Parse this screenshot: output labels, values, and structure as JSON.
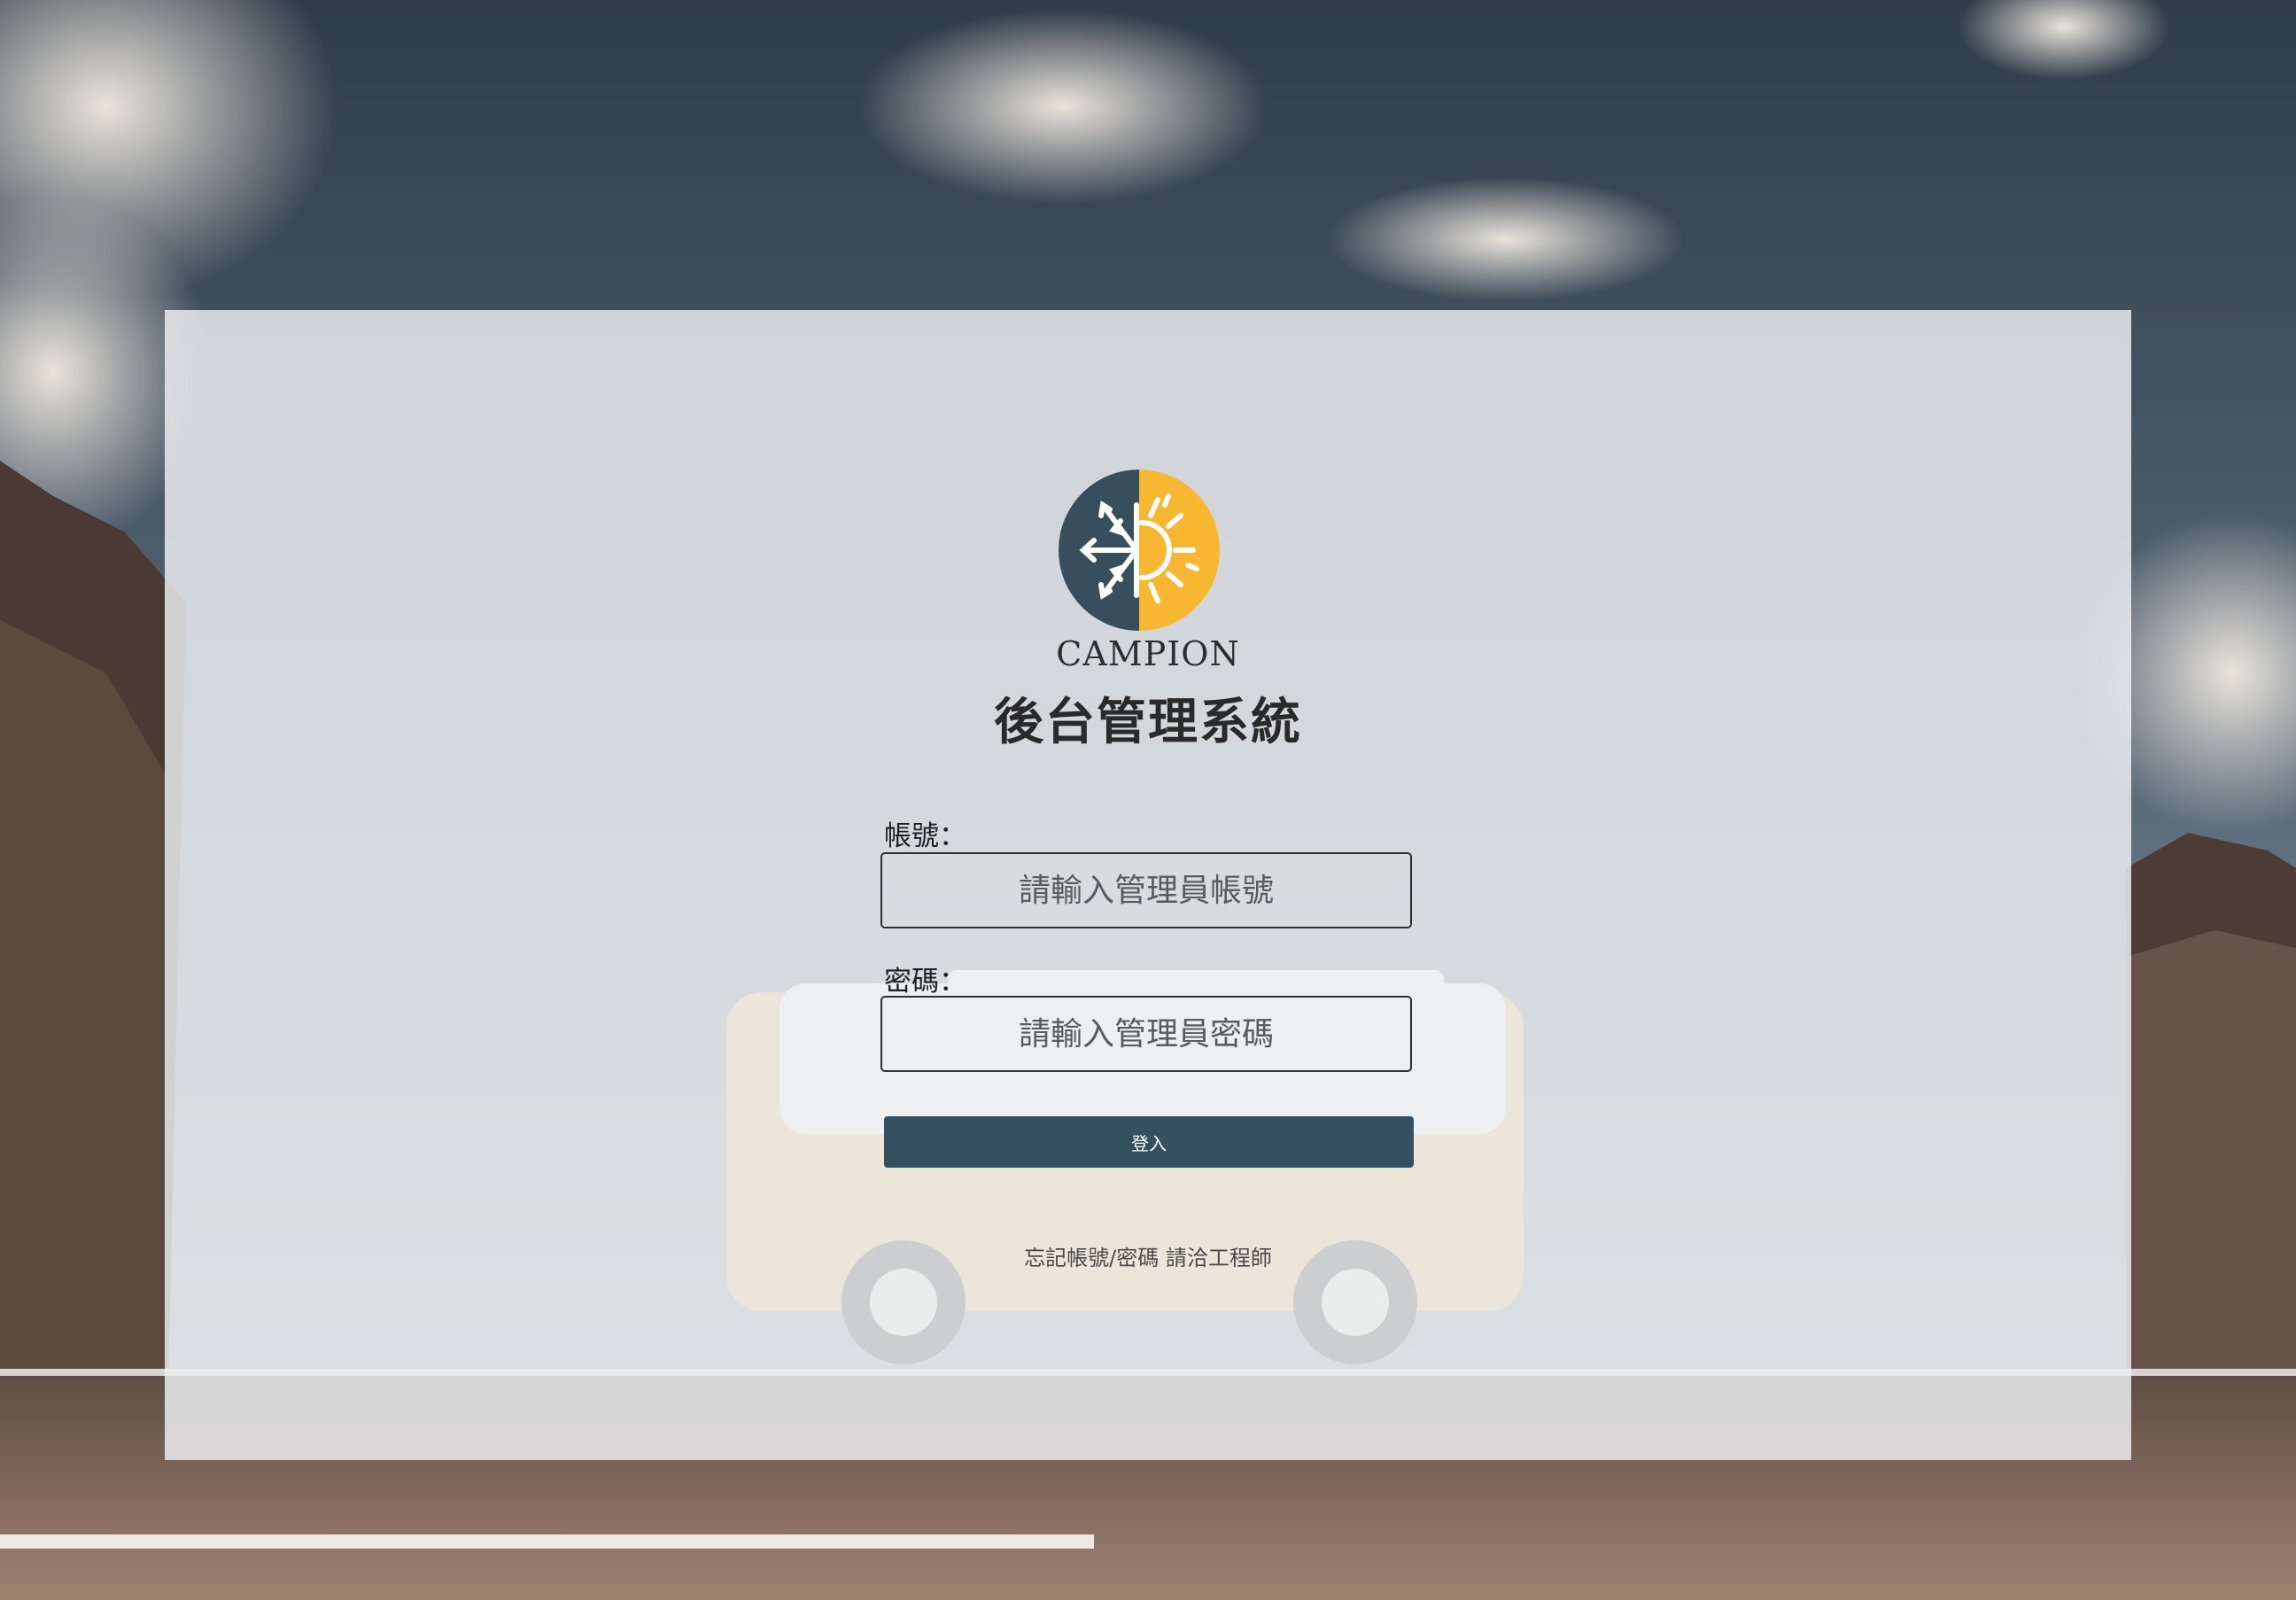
{
  "brand": {
    "name": "CAMPION",
    "logo_icon": "snowflake-sun-icon",
    "logo_colors": {
      "left": "#374f5d",
      "right": "#f7b731",
      "glyph": "#ffffff"
    }
  },
  "login": {
    "title": "後台管理系統",
    "account_label": "帳號：",
    "account_placeholder": "請輸入管理員帳號",
    "account_value": "",
    "password_label": "密碼：",
    "password_placeholder": "請輸入管理員密碼",
    "password_value": "",
    "submit_label": "登入",
    "help_text": "忘記帳號/密碼 請洽工程師"
  },
  "theme": {
    "accent": "#35505f",
    "van_color": "#e8b25c"
  }
}
